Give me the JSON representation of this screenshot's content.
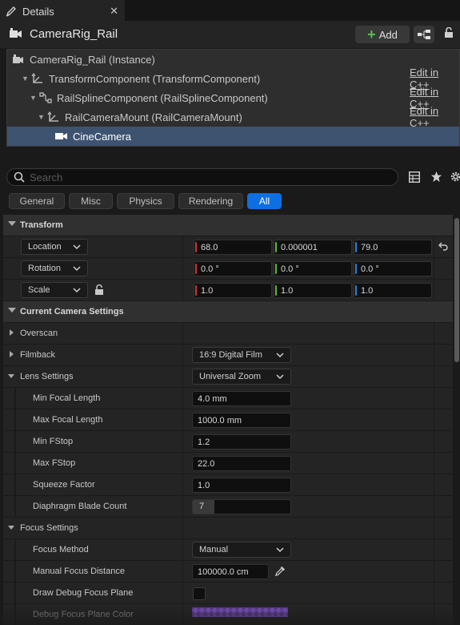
{
  "tab": {
    "label": "Details",
    "icon": "pencil-icon",
    "close": "✕"
  },
  "header": {
    "actor_name": "CameraRig_Rail",
    "add_label": "Add"
  },
  "tree": [
    {
      "label": "CameraRig_Rail (Instance)",
      "edit": ""
    },
    {
      "label": "TransformComponent (TransformComponent)",
      "edit": "Edit in C++"
    },
    {
      "label": "RailSplineComponent (RailSplineComponent)",
      "edit": "Edit in C++"
    },
    {
      "label": "RailCameraMount (RailCameraMount)",
      "edit": "Edit in C++"
    },
    {
      "label": "CineCamera",
      "edit": ""
    }
  ],
  "search": {
    "placeholder": "Search"
  },
  "filters": [
    "General",
    "Misc",
    "Physics",
    "Rendering",
    "All"
  ],
  "transform": {
    "title": "Transform",
    "location_label": "Location",
    "rotation_label": "Rotation",
    "scale_label": "Scale",
    "location": [
      "68.0",
      "0.000001",
      "79.0"
    ],
    "rotation": [
      "0.0 °",
      "0.0 °",
      "0.0 °"
    ],
    "scale": [
      "1.0",
      "1.0",
      "1.0"
    ]
  },
  "camera": {
    "title": "Current Camera Settings",
    "overscan": "Overscan",
    "filmback_label": "Filmback",
    "filmback_value": "16:9 Digital Film",
    "lens_label": "Lens Settings",
    "lens_value": "Universal Zoom",
    "min_focal_label": "Min Focal Length",
    "min_focal": "4.0 mm",
    "max_focal_label": "Max Focal Length",
    "max_focal": "1000.0 mm",
    "min_fstop_label": "Min FStop",
    "min_fstop": "1.2",
    "max_fstop_label": "Max FStop",
    "max_fstop": "22.0",
    "squeeze_label": "Squeeze Factor",
    "squeeze": "1.0",
    "blade_label": "Diaphragm Blade Count",
    "blade": "7",
    "blade_fill": 0.22,
    "focus_label": "Focus Settings",
    "focus_method_label": "Focus Method",
    "focus_method": "Manual",
    "manual_focus_label": "Manual Focus Distance",
    "manual_focus": "100000.0 cm",
    "draw_debug_label": "Draw Debug Focus Plane",
    "debug_color_label": "Debug Focus Plane Color"
  }
}
